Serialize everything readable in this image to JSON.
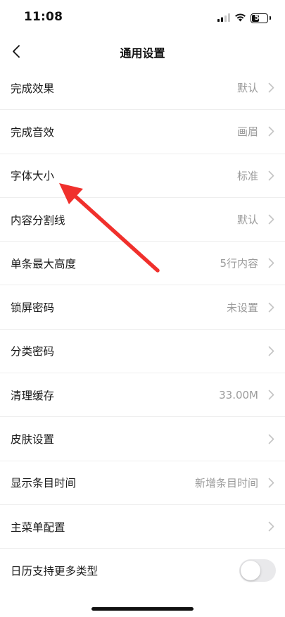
{
  "status_bar": {
    "time": "11:08",
    "battery_level": "53",
    "icons": [
      "cellular-signal-icon",
      "wifi-icon",
      "battery-icon"
    ]
  },
  "nav": {
    "title": "通用设置",
    "back_icon": "chevron-left-icon"
  },
  "settings": [
    {
      "label": "完成效果",
      "value": "默认",
      "control": "chevron"
    },
    {
      "label": "完成音效",
      "value": "画眉",
      "control": "chevron"
    },
    {
      "label": "字体大小",
      "value": "标准",
      "control": "chevron"
    },
    {
      "label": "内容分割线",
      "value": "默认",
      "control": "chevron"
    },
    {
      "label": "单条最大高度",
      "value": "5行内容",
      "control": "chevron"
    },
    {
      "label": "锁屏密码",
      "value": "未设置",
      "control": "chevron"
    },
    {
      "label": "分类密码",
      "value": "",
      "control": "chevron"
    },
    {
      "label": "清理缓存",
      "value": "33.00M",
      "control": "chevron"
    },
    {
      "label": "皮肤设置",
      "value": "",
      "control": "chevron"
    },
    {
      "label": "显示条目时间",
      "value": "新增条目时间",
      "control": "chevron"
    },
    {
      "label": "主菜单配置",
      "value": "",
      "control": "chevron"
    },
    {
      "label": "日历支持更多类型",
      "value": "",
      "control": "toggle",
      "toggle_on": false
    }
  ],
  "colors": {
    "text_primary": "#1a1a1a",
    "text_secondary": "#9b9b9b",
    "divider": "#eeeeee",
    "chevron": "#c4c4c4",
    "toggle_off": "#e9e9eb",
    "annotation_arrow": "#f0302c"
  }
}
